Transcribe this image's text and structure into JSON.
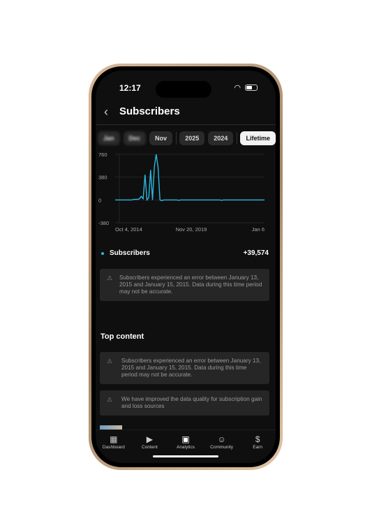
{
  "status": {
    "time": "12:17"
  },
  "header": {
    "title": "Subscribers"
  },
  "chips": [
    {
      "label": "Jan",
      "blurred": true
    },
    {
      "label": "Dec",
      "blurred": true
    },
    {
      "label": "Nov"
    },
    {
      "label": "2025"
    },
    {
      "label": "2024"
    },
    {
      "label": "Lifetime",
      "active": true
    }
  ],
  "chart_data": {
    "type": "line",
    "series": [
      {
        "name": "Subscribers",
        "color": "#2bb8e0",
        "values": [
          0,
          0,
          0,
          0,
          0,
          0,
          0,
          0,
          0,
          0,
          10,
          10,
          10,
          20,
          60,
          20,
          420,
          0,
          40,
          500,
          0,
          560,
          760,
          540,
          0,
          -10,
          0,
          0,
          0,
          0,
          0,
          0,
          0,
          0,
          -5,
          0,
          0,
          0,
          0,
          0,
          0,
          0,
          0,
          0,
          0,
          0,
          0,
          0,
          0,
          0,
          0,
          0,
          0,
          0,
          0,
          0,
          0,
          -5,
          0,
          0,
          0,
          0,
          0,
          0,
          0,
          0,
          0,
          0,
          0,
          0,
          0,
          0,
          0,
          0,
          0,
          0,
          0,
          0,
          0,
          0,
          0
        ]
      }
    ],
    "x_tick_labels": [
      "Oct 4, 2014",
      "Nov 20, 2019",
      "Jan 6"
    ],
    "y_tick_labels": [
      "760",
      "380",
      "0",
      "-380"
    ],
    "ylim": [
      -380,
      760
    ],
    "grid": true
  },
  "legend": {
    "label": "Subscribers",
    "value": "+39,574"
  },
  "notices": [
    "Subscribers experienced an error between January 13, 2015 and January 15, 2015. Data during this time period may not be accurate.",
    "Subscribers experienced an error between January 13, 2015 and January 15, 2015. Data during this time period may not be accurate.",
    "We have improved the data quality for subscription gain and loss sources"
  ],
  "top_content": {
    "title": "Top content"
  },
  "nav": [
    {
      "label": "Dashboard",
      "icon": "dashboard-icon"
    },
    {
      "label": "Content",
      "icon": "content-icon"
    },
    {
      "label": "Analytics",
      "icon": "analytics-icon",
      "active": true
    },
    {
      "label": "Community",
      "icon": "community-icon"
    },
    {
      "label": "Earn",
      "icon": "dollar-icon"
    }
  ]
}
